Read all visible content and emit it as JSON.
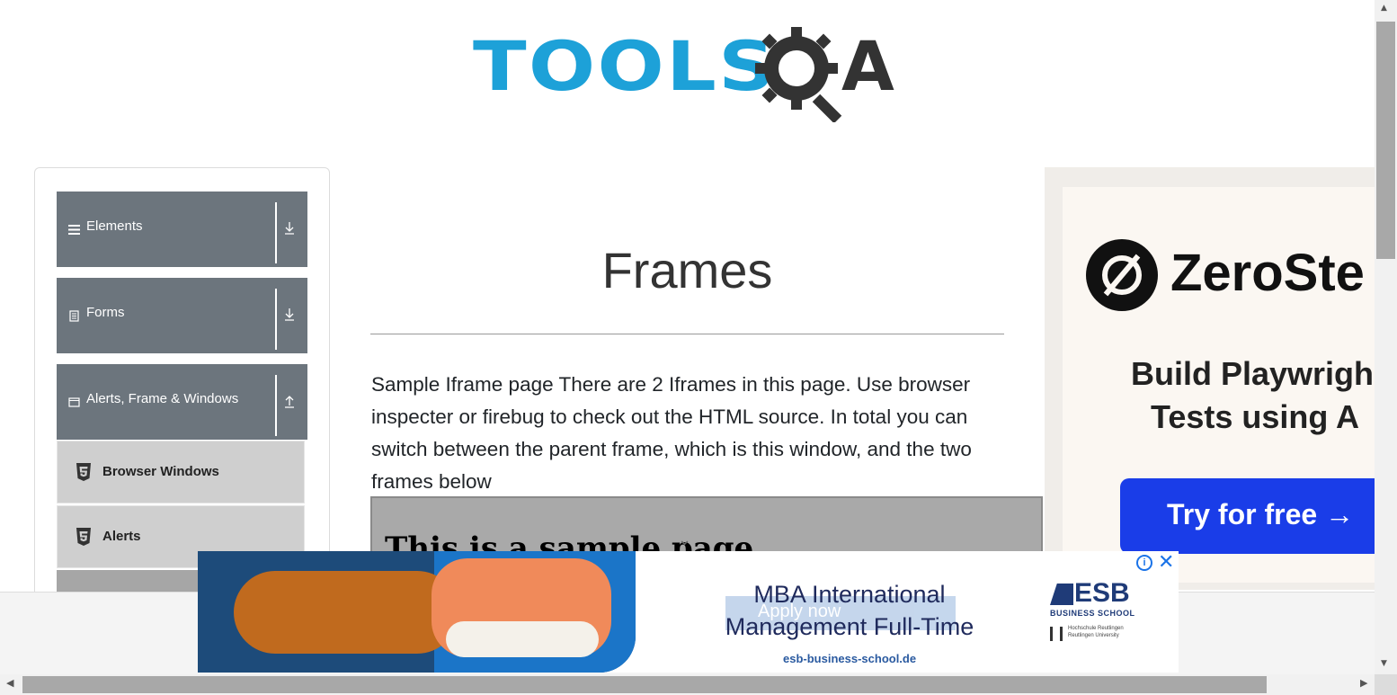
{
  "logo": {
    "tools": "TOOLS",
    "a": "A"
  },
  "sidebar": {
    "groups": [
      {
        "label": "Elements",
        "icon": "hamburger-icon",
        "arrow": "download-arrow-icon"
      },
      {
        "label": "Forms",
        "icon": "document-icon",
        "arrow": "download-arrow-icon"
      },
      {
        "label": "Alerts, Frame & Windows",
        "icon": "window-icon",
        "arrow": "upload-arrow-icon"
      }
    ],
    "items": [
      {
        "label": "Browser Windows",
        "icon": "html5-icon"
      },
      {
        "label": "Alerts",
        "icon": "html5-icon"
      }
    ]
  },
  "main": {
    "title": "Frames",
    "description": "Sample Iframe page There are 2 Iframes in this page. Use browser inspecter or firebug to check out the HTML source. In total you can switch between the parent frame, which is this window, and the two frames below",
    "frame1_heading": "This is a sample page"
  },
  "ad_right": {
    "brand": "ZeroSte",
    "headline_line1": "Build Playwrigh",
    "headline_line2": "Tests using A",
    "cta": "Try for free →",
    "colors": {
      "cta": "#1a3de8"
    }
  },
  "ad_bottom": {
    "ghost_button": "Apply now",
    "headline": "MBA International Management Full-Time",
    "url": "esb-business-school.de",
    "esb": "ESB",
    "esb_sub": "BUSINESS SCHOOL",
    "esb_uni": "Hochschule Reutlingen\nReutlingen University",
    "info": "i",
    "close": "✕"
  },
  "colors": {
    "accent": "#1da1d8",
    "sidebar_group": "#6c757d",
    "sidebar_item": "#cfcfcf"
  }
}
